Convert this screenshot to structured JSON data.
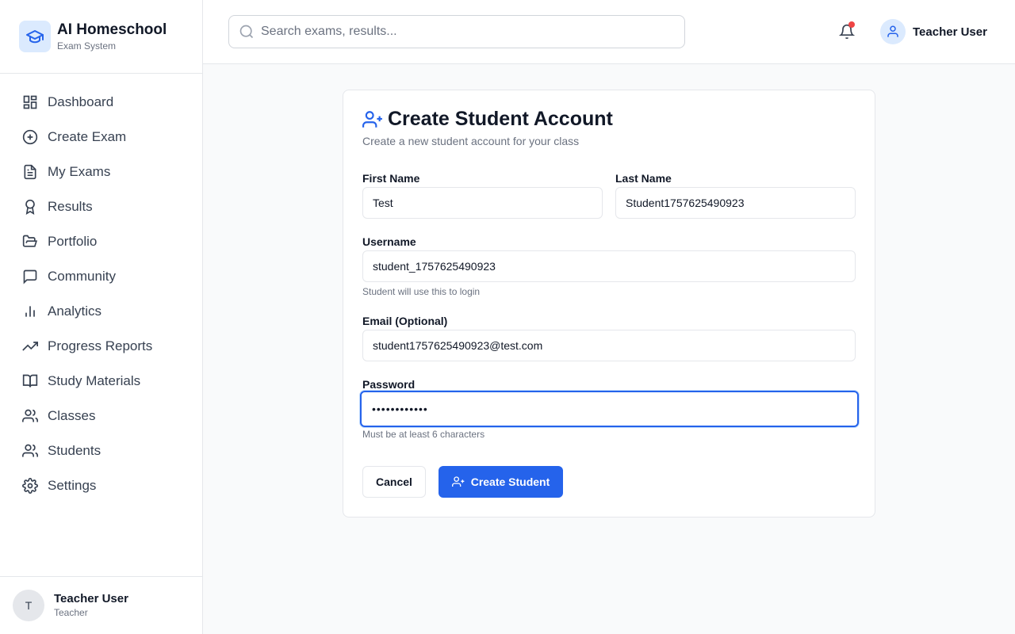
{
  "brand": {
    "title": "AI Homeschool",
    "subtitle": "Exam System",
    "logo_icon": "graduation-cap-icon"
  },
  "sidebar": {
    "items": [
      {
        "label": "Dashboard",
        "icon": "dashboard-icon"
      },
      {
        "label": "Create Exam",
        "icon": "plus-circle-icon"
      },
      {
        "label": "My Exams",
        "icon": "file-text-icon"
      },
      {
        "label": "Results",
        "icon": "award-icon"
      },
      {
        "label": "Portfolio",
        "icon": "folder-open-icon"
      },
      {
        "label": "Community",
        "icon": "message-square-icon"
      },
      {
        "label": "Analytics",
        "icon": "bar-chart-icon"
      },
      {
        "label": "Progress Reports",
        "icon": "trending-up-icon"
      },
      {
        "label": "Study Materials",
        "icon": "book-open-icon"
      },
      {
        "label": "Classes",
        "icon": "users-icon"
      },
      {
        "label": "Students",
        "icon": "users-icon"
      },
      {
        "label": "Settings",
        "icon": "gear-icon"
      }
    ],
    "user": {
      "initial": "T",
      "name": "Teacher User",
      "role": "Teacher"
    }
  },
  "topbar": {
    "search_placeholder": "Search exams, results...",
    "user_name": "Teacher User"
  },
  "form": {
    "title": "Create Student Account",
    "subtitle": "Create a new student account for your class",
    "first_name": {
      "label": "First Name",
      "value": "Test"
    },
    "last_name": {
      "label": "Last Name",
      "value": "Student1757625490923"
    },
    "username": {
      "label": "Username",
      "value": "student_1757625490923",
      "hint": "Student will use this to login"
    },
    "email": {
      "label": "Email (Optional)",
      "value": "student1757625490923@test.com"
    },
    "password": {
      "label": "Password",
      "value": "••••••••••••",
      "hint": "Must be at least 6 characters"
    },
    "cancel_label": "Cancel",
    "submit_label": "Create Student"
  },
  "colors": {
    "accent": "#2563eb",
    "notification_dot": "#ef4444",
    "logo_bg": "#dbeafe"
  }
}
